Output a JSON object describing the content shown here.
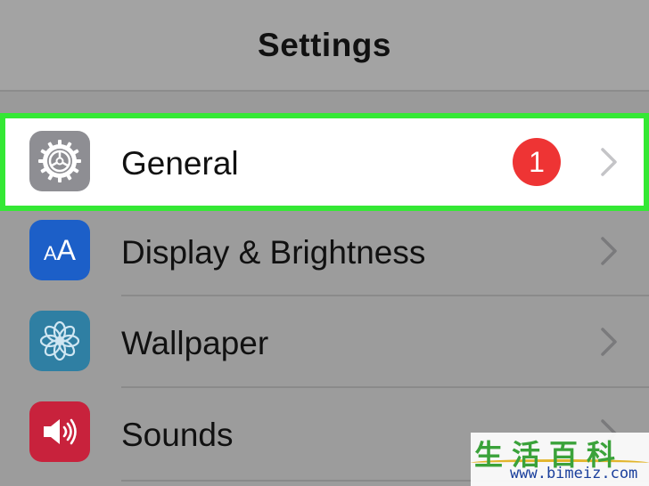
{
  "navbar": {
    "title": "Settings"
  },
  "rows": [
    {
      "id": "general",
      "label": "General",
      "icon": "gear-icon",
      "icon_color": "#8e8e93",
      "badge": "1",
      "highlighted": true
    },
    {
      "id": "display",
      "label": "Display & Brightness",
      "icon": "display-brightness-icon",
      "icon_color": "#1c5fc8",
      "icon_text": "AA"
    },
    {
      "id": "wallpaper",
      "label": "Wallpaper",
      "icon": "flower-icon",
      "icon_color": "#2f7fa3"
    },
    {
      "id": "sounds",
      "label": "Sounds",
      "icon": "speaker-icon",
      "icon_color": "#c8223c"
    }
  ],
  "colors": {
    "highlight_border": "#34e834",
    "badge": "#ee3434",
    "dim_overlay": "#9a9a9a"
  },
  "watermark": {
    "text_cn": "生活百科",
    "url": "www.bimeiz.com"
  }
}
